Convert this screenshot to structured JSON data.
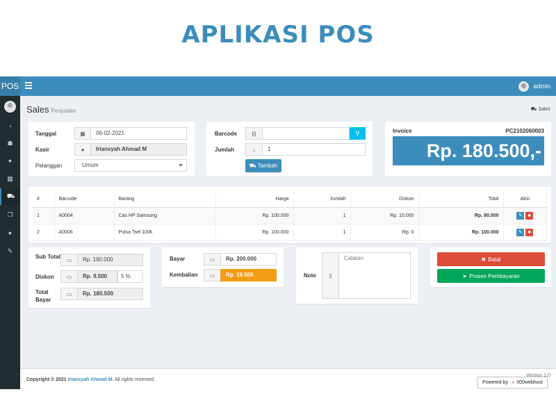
{
  "banner": {
    "title": "APLIKASI POS"
  },
  "topbar": {
    "logo": "POS",
    "user": "admin"
  },
  "sidebar": {
    "items": [
      {
        "icon": "dashboard-icon",
        "glyph": "◔"
      },
      {
        "icon": "users-icon",
        "glyph": "☗"
      },
      {
        "icon": "user-icon",
        "glyph": "●"
      },
      {
        "icon": "grid-icon",
        "glyph": "▦"
      },
      {
        "icon": "cart-icon",
        "glyph": "⛟"
      },
      {
        "icon": "copy-icon",
        "glyph": "❐"
      },
      {
        "icon": "user2-icon",
        "glyph": "●"
      },
      {
        "icon": "wrench-icon",
        "glyph": "✎"
      }
    ]
  },
  "page": {
    "title": "Sales",
    "subtitle": "Penjualan",
    "breadcrumb": "Sales"
  },
  "form1": {
    "tanggal_label": "Tanggal",
    "tanggal_value": "06-02-2021",
    "kasir_label": "Kasir",
    "kasir_value": "Iriansyah Ahmad M",
    "pelanggan_label": "Pelanggan",
    "pelanggan_value": "Umum"
  },
  "form2": {
    "barcode_label": "Barcode",
    "barcode_value": "",
    "jumlah_label": "Jumlah",
    "jumlah_value": "1",
    "tambah_label": "Tambah"
  },
  "invoice": {
    "label": "Invoice",
    "number": "PC2102060003",
    "total": "Rp. 180.500,-"
  },
  "table": {
    "headers": [
      "#",
      "Barcode",
      "Barang",
      "Harga",
      "Jumlah",
      "Diskon",
      "Total",
      "Aksi"
    ],
    "rows": [
      [
        "1",
        "A0004",
        "Cas HP Samsung",
        "Rp. 100.000",
        "1",
        "Rp. 10.000",
        "Rp. 90.000"
      ],
      [
        "2",
        "A0006",
        "Pulsa Tsel 100k",
        "Rp. 100.000",
        "1",
        "Rp. 0",
        "Rp. 100.000"
      ]
    ]
  },
  "summary": {
    "subtotal_label": "Sub Total",
    "subtotal_value": "Rp. 190.000",
    "diskon_label": "Diskon",
    "diskon_value": "Rp. 9.500",
    "diskon_pct": "5 %",
    "total_label": "Total Bayar",
    "total_value": "Rp. 180.500"
  },
  "payment": {
    "bayar_label": "Bayar",
    "bayar_value": "Rp. 200.000",
    "kembalian_label": "Kembalian",
    "kembalian_value": "Rp. 19.500"
  },
  "note": {
    "label": "Note",
    "placeholder": "Catatan"
  },
  "actions": {
    "batal": "Batal",
    "proses": "Proses Pembayaran"
  },
  "footer": {
    "copyright_prefix": "Copyright © 2021",
    "author": "Iriansyah Ahmad M.",
    "rights": "All rights reserved.",
    "version": "Version 1.0",
    "powered_by": "Powered by",
    "host": "000webhost"
  },
  "colors": {
    "primary": "#3c8dbc",
    "danger": "#dd4b39",
    "success": "#00a65a",
    "warning": "#f39c12"
  }
}
